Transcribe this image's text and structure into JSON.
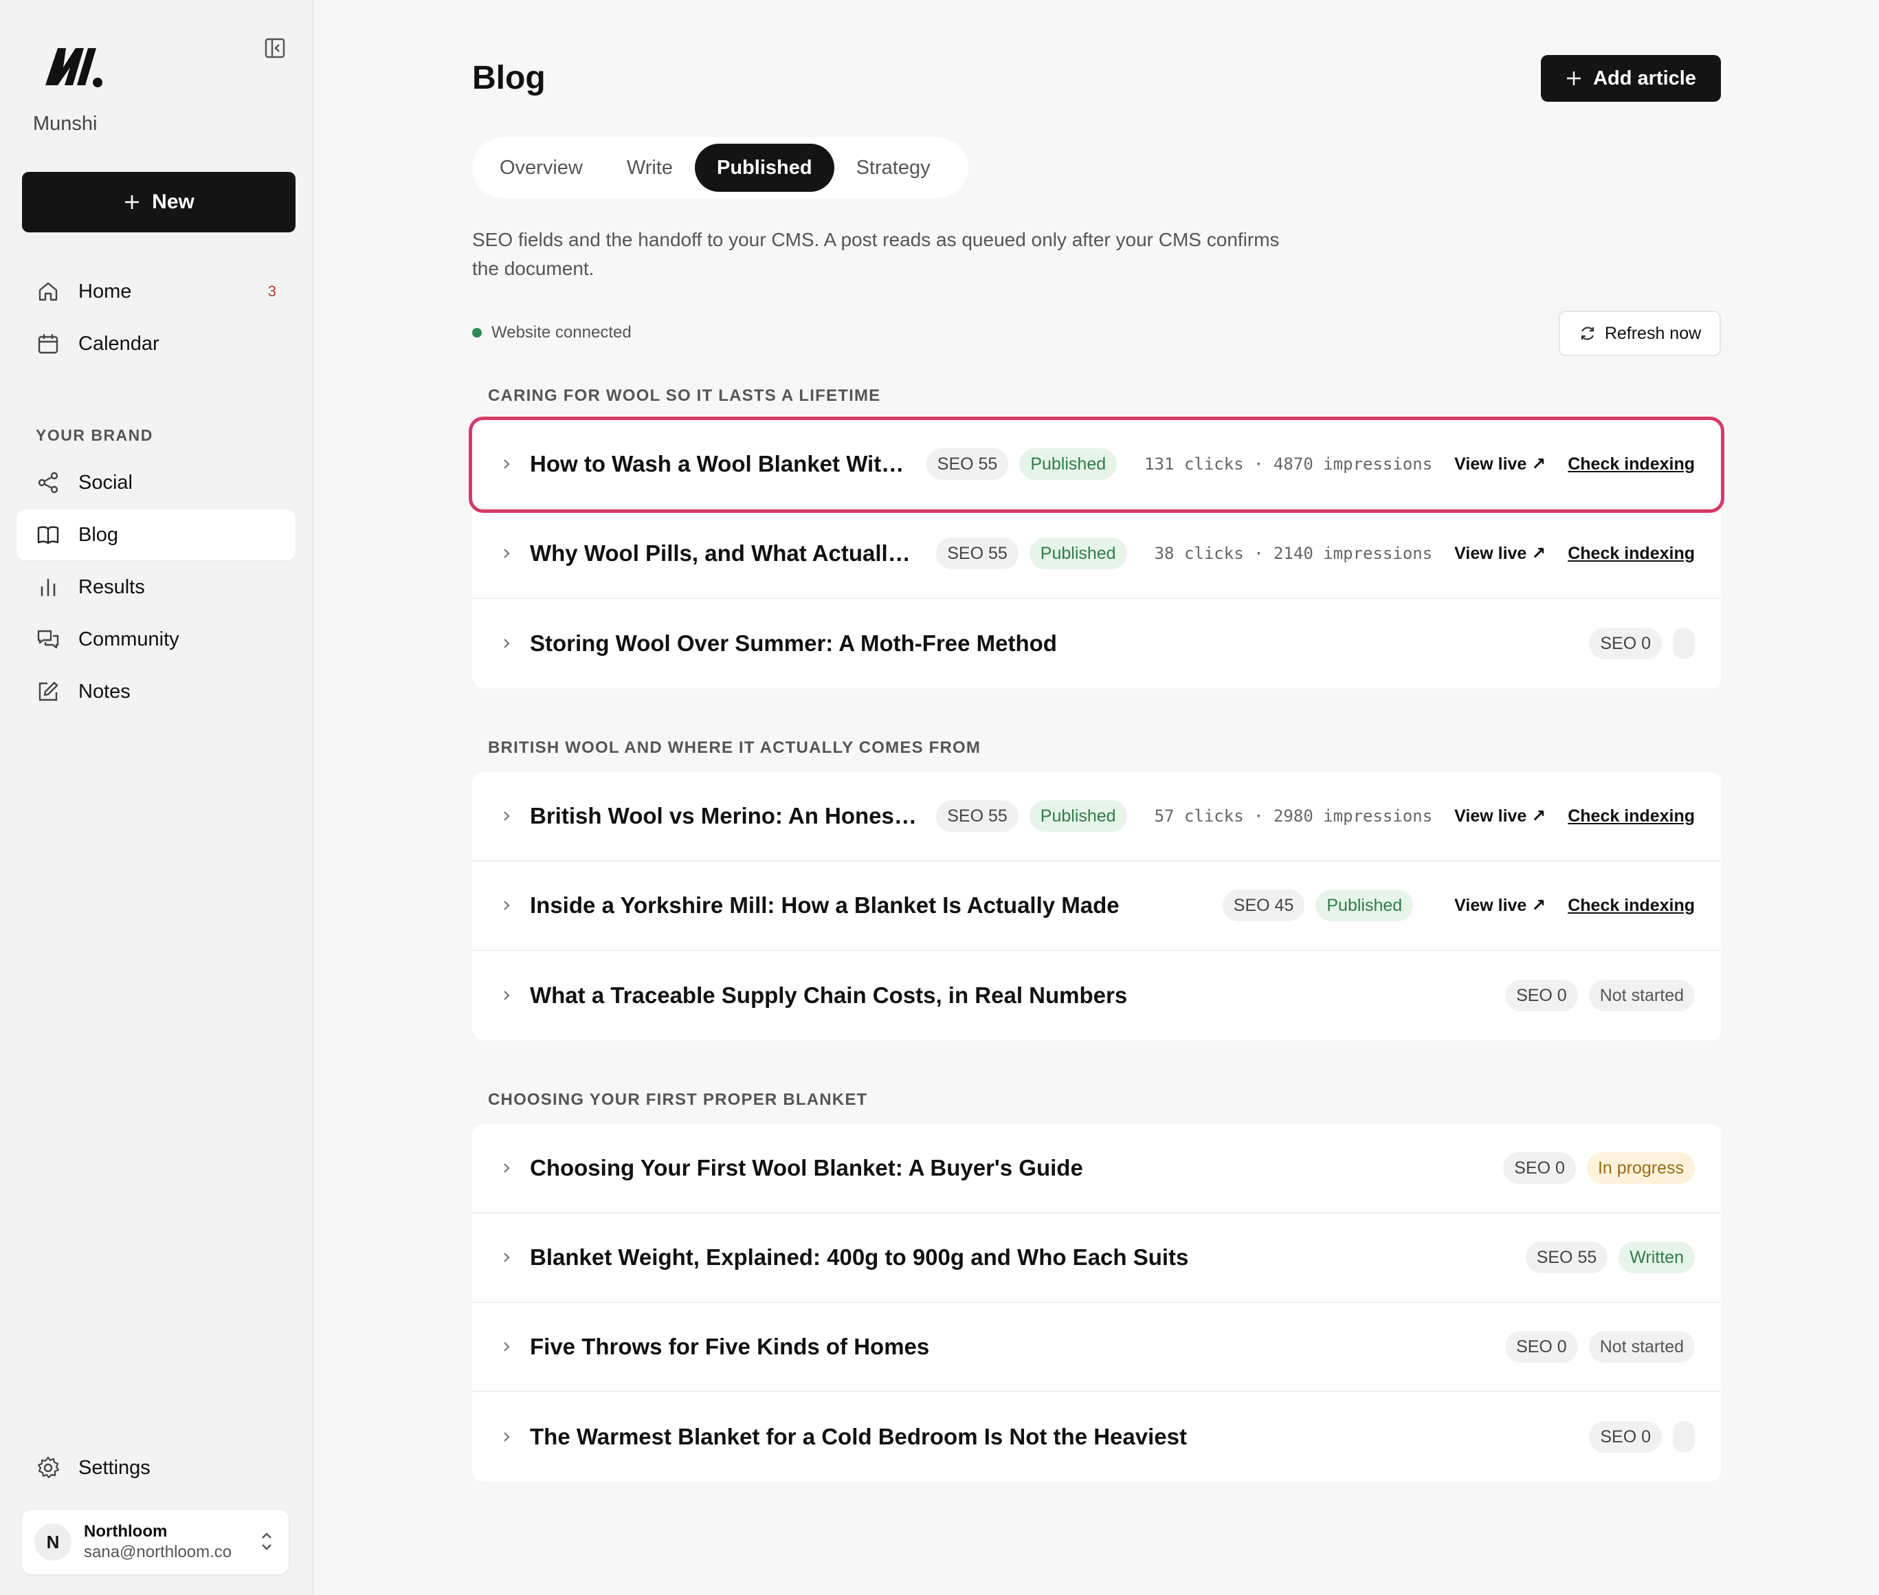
{
  "sidebar": {
    "brand": "Munshi",
    "new_label": "New",
    "nav": [
      {
        "label": "Home",
        "badge": "3"
      },
      {
        "label": "Calendar"
      }
    ],
    "section_label": "YOUR BRAND",
    "brand_nav": [
      {
        "label": "Social"
      },
      {
        "label": "Blog"
      },
      {
        "label": "Results"
      },
      {
        "label": "Community"
      },
      {
        "label": "Notes"
      }
    ],
    "settings_label": "Settings",
    "account": {
      "initial": "N",
      "name": "Northloom",
      "email": "sana@northloom.co"
    }
  },
  "header": {
    "title": "Blog",
    "add_label": "Add article"
  },
  "tabs": [
    "Overview",
    "Write",
    "Published",
    "Strategy"
  ],
  "active_tab": "Published",
  "description": "SEO fields and the handoff to your CMS. A post reads as queued only after your CMS confirms the document.",
  "connection": {
    "status": "Website connected",
    "refresh_label": "Refresh now"
  },
  "groups": [
    {
      "label": "CARING FOR WOOL SO IT LASTS A LIFETIME",
      "rows": [
        {
          "title": "How to Wash a Wool Blanket Witho...",
          "seo": "SEO 55",
          "status": "Published",
          "stats": "131 clicks · 4870 impressions",
          "view_live": "View live ↗",
          "check": "Check indexing"
        },
        {
          "title": "Why Wool Pills, and What Actually S...",
          "seo": "SEO 55",
          "status": "Published",
          "stats": "38 clicks · 2140 impressions",
          "view_live": "View live ↗",
          "check": "Check indexing"
        },
        {
          "title": "Storing Wool Over Summer: A Moth-Free Method",
          "seo": "SEO 0",
          "status": ""
        }
      ]
    },
    {
      "label": "BRITISH WOOL AND WHERE IT ACTUALLY COMES FROM",
      "rows": [
        {
          "title": "British Wool vs Merino: An Honest C...",
          "seo": "SEO 55",
          "status": "Published",
          "stats": "57 clicks · 2980 impressions",
          "view_live": "View live ↗",
          "check": "Check indexing"
        },
        {
          "title": "Inside a Yorkshire Mill: How a Blanket Is Actually Made",
          "seo": "SEO 45",
          "status": "Published",
          "view_live": "View live ↗",
          "check": "Check indexing"
        },
        {
          "title": "What a Traceable Supply Chain Costs, in Real Numbers",
          "seo": "SEO 0",
          "status": "Not started"
        }
      ]
    },
    {
      "label": "CHOOSING YOUR FIRST PROPER BLANKET",
      "rows": [
        {
          "title": "Choosing Your First Wool Blanket: A Buyer's Guide",
          "seo": "SEO 0",
          "status": "In progress"
        },
        {
          "title": "Blanket Weight, Explained: 400g to 900g and Who Each Suits",
          "seo": "SEO 55",
          "status": "Written"
        },
        {
          "title": "Five Throws for Five Kinds of Homes",
          "seo": "SEO 0",
          "status": "Not started"
        },
        {
          "title": "The Warmest Blanket for a Cold Bedroom Is Not the Heaviest",
          "seo": "SEO 0",
          "status": ""
        }
      ]
    }
  ],
  "colors": {
    "accent_dark": "#141414",
    "highlight": "#d63a67",
    "connected": "#2e8b57",
    "published_bg": "#e7f4ea",
    "in_progress_bg": "#fdf2dc"
  }
}
